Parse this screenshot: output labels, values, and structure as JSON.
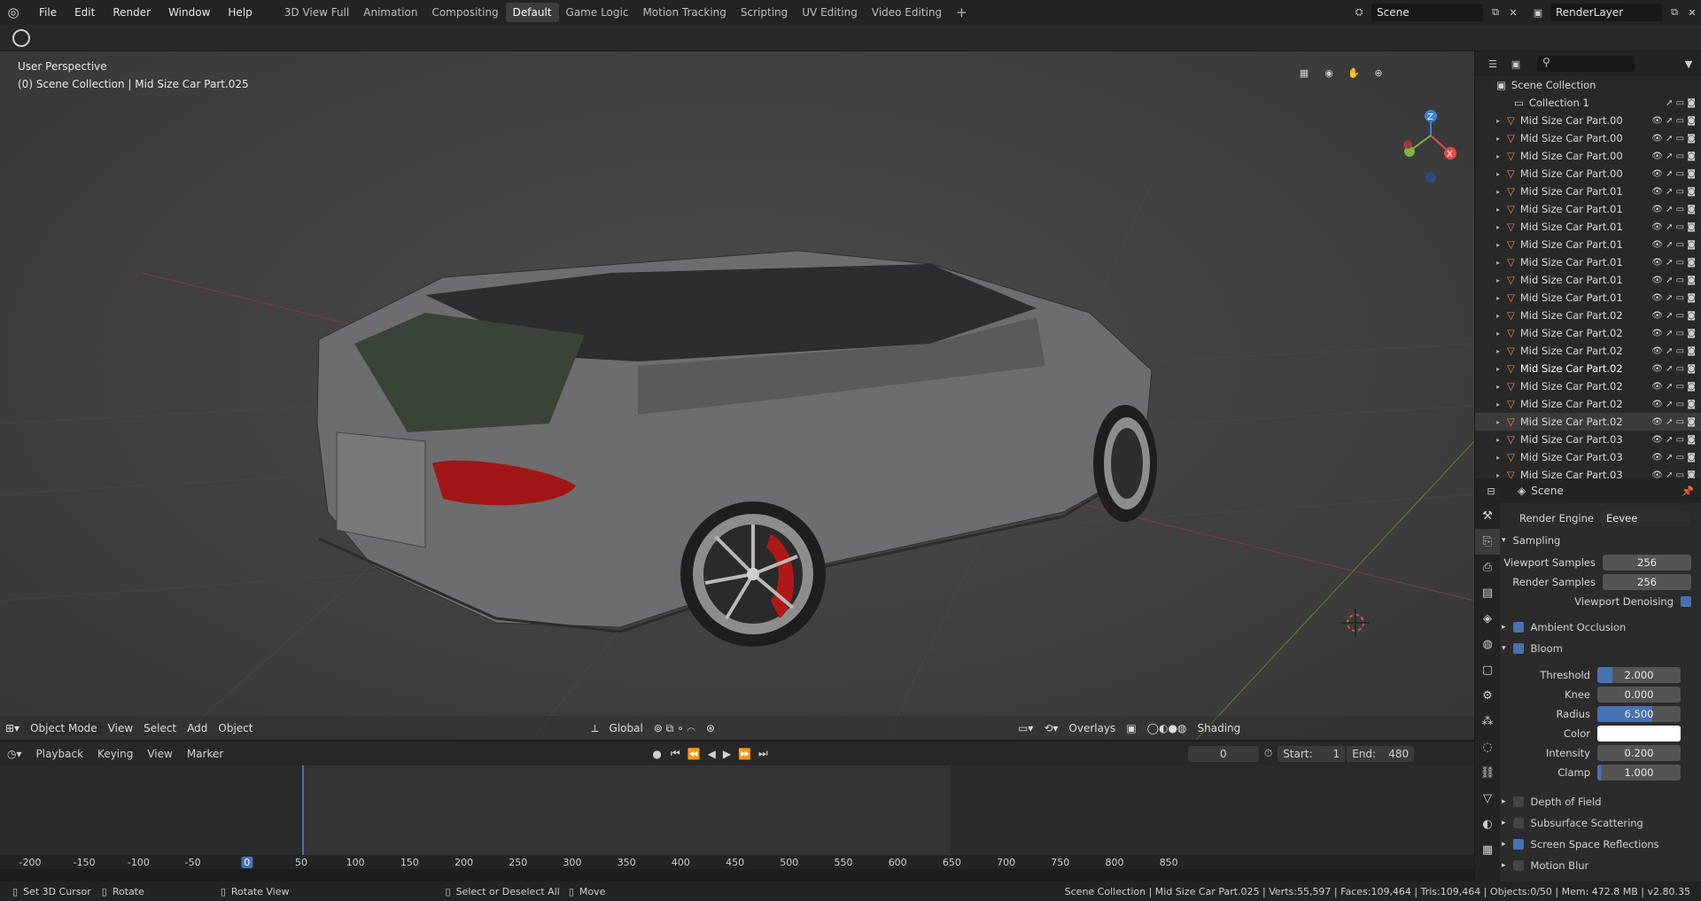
{
  "menu": [
    "File",
    "Edit",
    "Render",
    "Window",
    "Help"
  ],
  "workspaces": [
    "3D View Full",
    "Animation",
    "Compositing",
    "Default",
    "Game Logic",
    "Motion Tracking",
    "Scripting",
    "UV Editing",
    "Video Editing"
  ],
  "active_workspace": "Default",
  "scene_field": "Scene",
  "renderlayer_field": "RenderLayer",
  "viewport": {
    "label1": "User Perspective",
    "label2": "(0) Scene Collection | Mid Size Car Part.025",
    "mode": "Object Mode",
    "menus": [
      "View",
      "Select",
      "Add",
      "Object"
    ],
    "orientation": "Global",
    "overlays": "Overlays",
    "shading": "Shading",
    "axes": {
      "z": "Z",
      "x": "X"
    }
  },
  "timeline": {
    "playback": "Playback",
    "keying": "Keying",
    "view": "View",
    "marker": "Marker",
    "current_frame": "0",
    "start_label": "Start:",
    "start": "1",
    "end_label": "End:",
    "end": "480",
    "ticks": [
      "-200",
      "-150",
      "-100",
      "-50",
      "0",
      "50",
      "100",
      "150",
      "200",
      "250",
      "300",
      "350",
      "400",
      "450",
      "500",
      "550",
      "600",
      "650",
      "700",
      "750",
      "800",
      "850"
    ]
  },
  "status": {
    "left": [
      "Set 3D Cursor",
      "Rotate",
      "Rotate View",
      "Select or Deselect All",
      "Move"
    ],
    "right": "Scene Collection | Mid Size Car Part.025 | Verts:55,597 | Faces:109,464 | Tris:109,464 | Objects:0/50 | Mem: 472.8 MB | v2.80.35"
  },
  "outliner": {
    "root": "Scene Collection",
    "collection": "Collection 1",
    "items": [
      "Mid Size Car Part.00",
      "Mid Size Car Part.00",
      "Mid Size Car Part.00",
      "Mid Size Car Part.00",
      "Mid Size Car Part.01",
      "Mid Size Car Part.01",
      "Mid Size Car Part.01",
      "Mid Size Car Part.01",
      "Mid Size Car Part.01",
      "Mid Size Car Part.01",
      "Mid Size Car Part.01",
      "Mid Size Car Part.02",
      "Mid Size Car Part.02",
      "Mid Size Car Part.02",
      "Mid Size Car Part.02",
      "Mid Size Car Part.02",
      "Mid Size Car Part.02",
      "Mid Size Car Part.02",
      "Mid Size Car Part.03",
      "Mid Size Car Part.03",
      "Mid Size Car Part.03"
    ]
  },
  "properties": {
    "header": "Scene",
    "render_engine_label": "Render Engine",
    "render_engine": "Eevee",
    "sampling": "Sampling",
    "viewport_samples_label": "Viewport Samples",
    "viewport_samples": "256",
    "render_samples_label": "Render Samples",
    "render_samples": "256",
    "viewport_denoising": "Viewport Denoising",
    "ambient_occlusion": "Ambient Occlusion",
    "bloom": "Bloom",
    "threshold_label": "Threshold",
    "threshold": "2.000",
    "knee_label": "Knee",
    "knee": "0.000",
    "radius_label": "Radius",
    "radius": "6.500",
    "color_label": "Color",
    "intensity_label": "Intensity",
    "intensity": "0.200",
    "clamp_label": "Clamp",
    "clamp": "1.000",
    "depth_of_field": "Depth of Field",
    "subsurface": "Subsurface Scattering",
    "ssr": "Screen Space Reflections",
    "motion_blur": "Motion Blur"
  },
  "colors": {
    "accent": "#4772b3",
    "orange": "#e8894a",
    "red_axis": "#e24a4a",
    "green_axis": "#7fb341",
    "blue_axis": "#3d82d6"
  }
}
